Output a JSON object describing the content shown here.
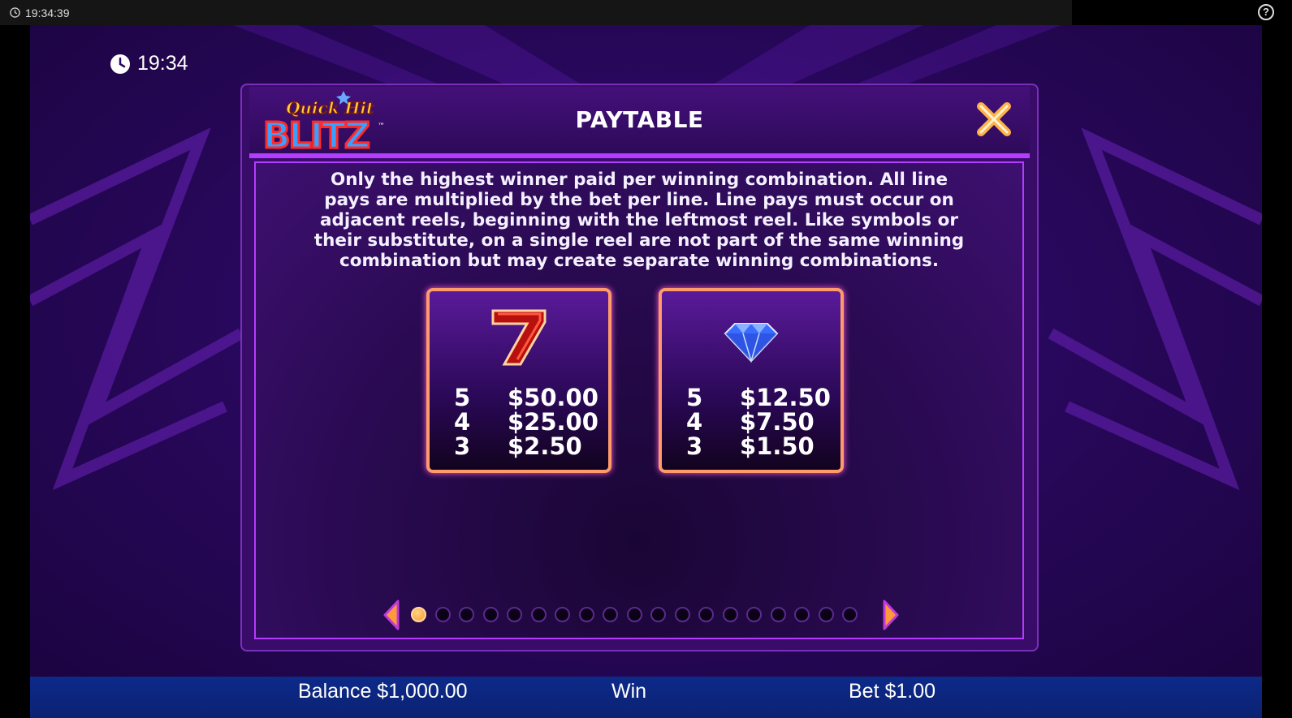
{
  "system_bar": {
    "time": "19:34:39",
    "clock_icon": "clock-icon",
    "help_icon": "help-icon"
  },
  "game_clock": {
    "time": "19:34",
    "icon": "clock-icon"
  },
  "panel": {
    "logo_text": {
      "line1": "Quick Hit",
      "line2": "BLITZ",
      "tm": "™"
    },
    "title": "PAYTABLE",
    "close_icon": "close-icon",
    "description": "Only the highest winner paid per winning combination. All line pays are multiplied by the bet per line. Line pays must occur on adjacent reels, beginning with the leftmost reel. Like symbols or their substitute, on a single reel are not part of the same winning combination but may create separate winning combinations.",
    "paytable": [
      {
        "symbol": "red-seven",
        "rows": [
          {
            "count": "5",
            "pay": "$50.00"
          },
          {
            "count": "4",
            "pay": "$25.00"
          },
          {
            "count": "3",
            "pay": "$2.50"
          }
        ]
      },
      {
        "symbol": "diamond",
        "rows": [
          {
            "count": "5",
            "pay": "$12.50"
          },
          {
            "count": "4",
            "pay": "$7.50"
          },
          {
            "count": "3",
            "pay": "$1.50"
          }
        ]
      }
    ],
    "pagination": {
      "current": 1,
      "total": 19
    }
  },
  "bottom_bar": {
    "balance": "Balance $1,000.00",
    "win": "Win",
    "bet": "Bet $1.00"
  },
  "colors": {
    "accent": "#b43cff",
    "box_border": "#ff9a6a",
    "bottom_bar": "#0b2272",
    "active_dot": "#ff9a2a"
  }
}
